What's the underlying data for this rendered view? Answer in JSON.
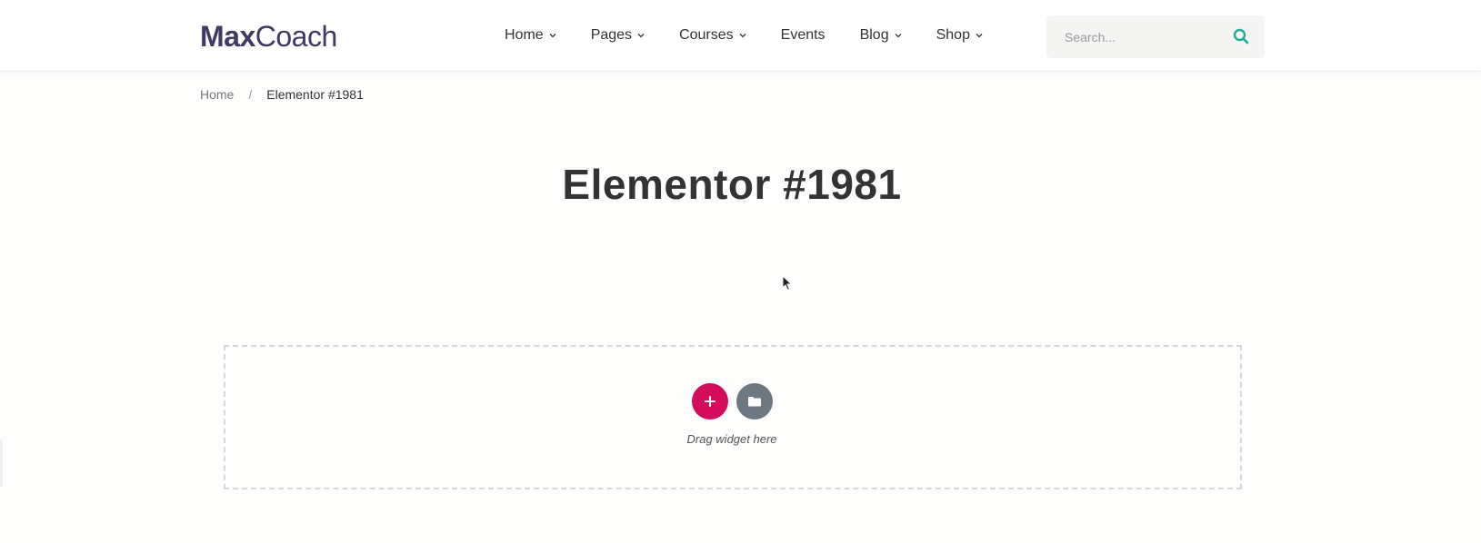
{
  "header": {
    "logo": {
      "bold": "Max",
      "light": "Coach"
    },
    "nav": [
      {
        "label": "Home",
        "dropdown": true
      },
      {
        "label": "Pages",
        "dropdown": true
      },
      {
        "label": "Courses",
        "dropdown": true
      },
      {
        "label": "Events",
        "dropdown": false
      },
      {
        "label": "Blog",
        "dropdown": true
      },
      {
        "label": "Shop",
        "dropdown": true
      }
    ],
    "search": {
      "placeholder": "Search...",
      "value": "",
      "icon": "search-icon"
    }
  },
  "breadcrumb": {
    "home": "Home",
    "separator": "/",
    "current": "Elementor #1981"
  },
  "page": {
    "title": "Elementor #1981"
  },
  "editor": {
    "add_label": "+",
    "add_icon": "plus-icon",
    "template_icon": "folder-icon",
    "drag_hint": "Drag widget here"
  },
  "colors": {
    "brand": "#3f3a64",
    "accent": "#20ad96",
    "add_button": "#d30c5c",
    "template_button": "#6d7882",
    "text": "#333333"
  }
}
